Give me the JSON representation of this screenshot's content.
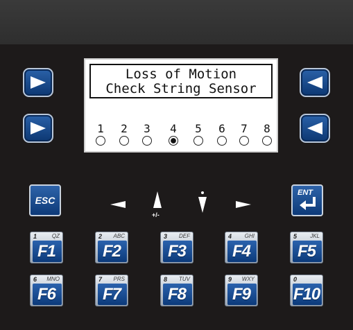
{
  "display": {
    "line1": "Loss of Motion",
    "line2": "Check String Sensor",
    "indicators": [
      {
        "label": "1",
        "on": false
      },
      {
        "label": "2",
        "on": false
      },
      {
        "label": "3",
        "on": false
      },
      {
        "label": "4",
        "on": true
      },
      {
        "label": "5",
        "on": false
      },
      {
        "label": "6",
        "on": false
      },
      {
        "label": "7",
        "on": false
      },
      {
        "label": "8",
        "on": false
      }
    ]
  },
  "keys": {
    "esc_label": "ESC",
    "ent_label": "ENT",
    "plus_minus": "+/-",
    "side_icons": [
      "arrow-right-icon",
      "arrow-right-icon",
      "arrow-left-icon",
      "arrow-left-icon"
    ],
    "nav_icons": [
      "arrow-left-icon",
      "arrow-up-icon",
      "arrow-down-icon",
      "arrow-right-icon"
    ]
  },
  "function_keys": [
    {
      "name": "F1",
      "digit": "1",
      "alpha": "QZ"
    },
    {
      "name": "F2",
      "digit": "2",
      "alpha": "ABC"
    },
    {
      "name": "F3",
      "digit": "3",
      "alpha": "DEF"
    },
    {
      "name": "F4",
      "digit": "4",
      "alpha": "GHI"
    },
    {
      "name": "F5",
      "digit": "5",
      "alpha": "JKL"
    },
    {
      "name": "F6",
      "digit": "6",
      "alpha": "MNO"
    },
    {
      "name": "F7",
      "digit": "7",
      "alpha": "PRS"
    },
    {
      "name": "F8",
      "digit": "8",
      "alpha": "TUV"
    },
    {
      "name": "F9",
      "digit": "9",
      "alpha": "WXY"
    },
    {
      "name": "F10",
      "digit": "0",
      "alpha": ""
    }
  ],
  "colors": {
    "key_blue": "#1a4f95",
    "bezel": "#1d1a1a",
    "lcd_background": "#ffffff"
  }
}
